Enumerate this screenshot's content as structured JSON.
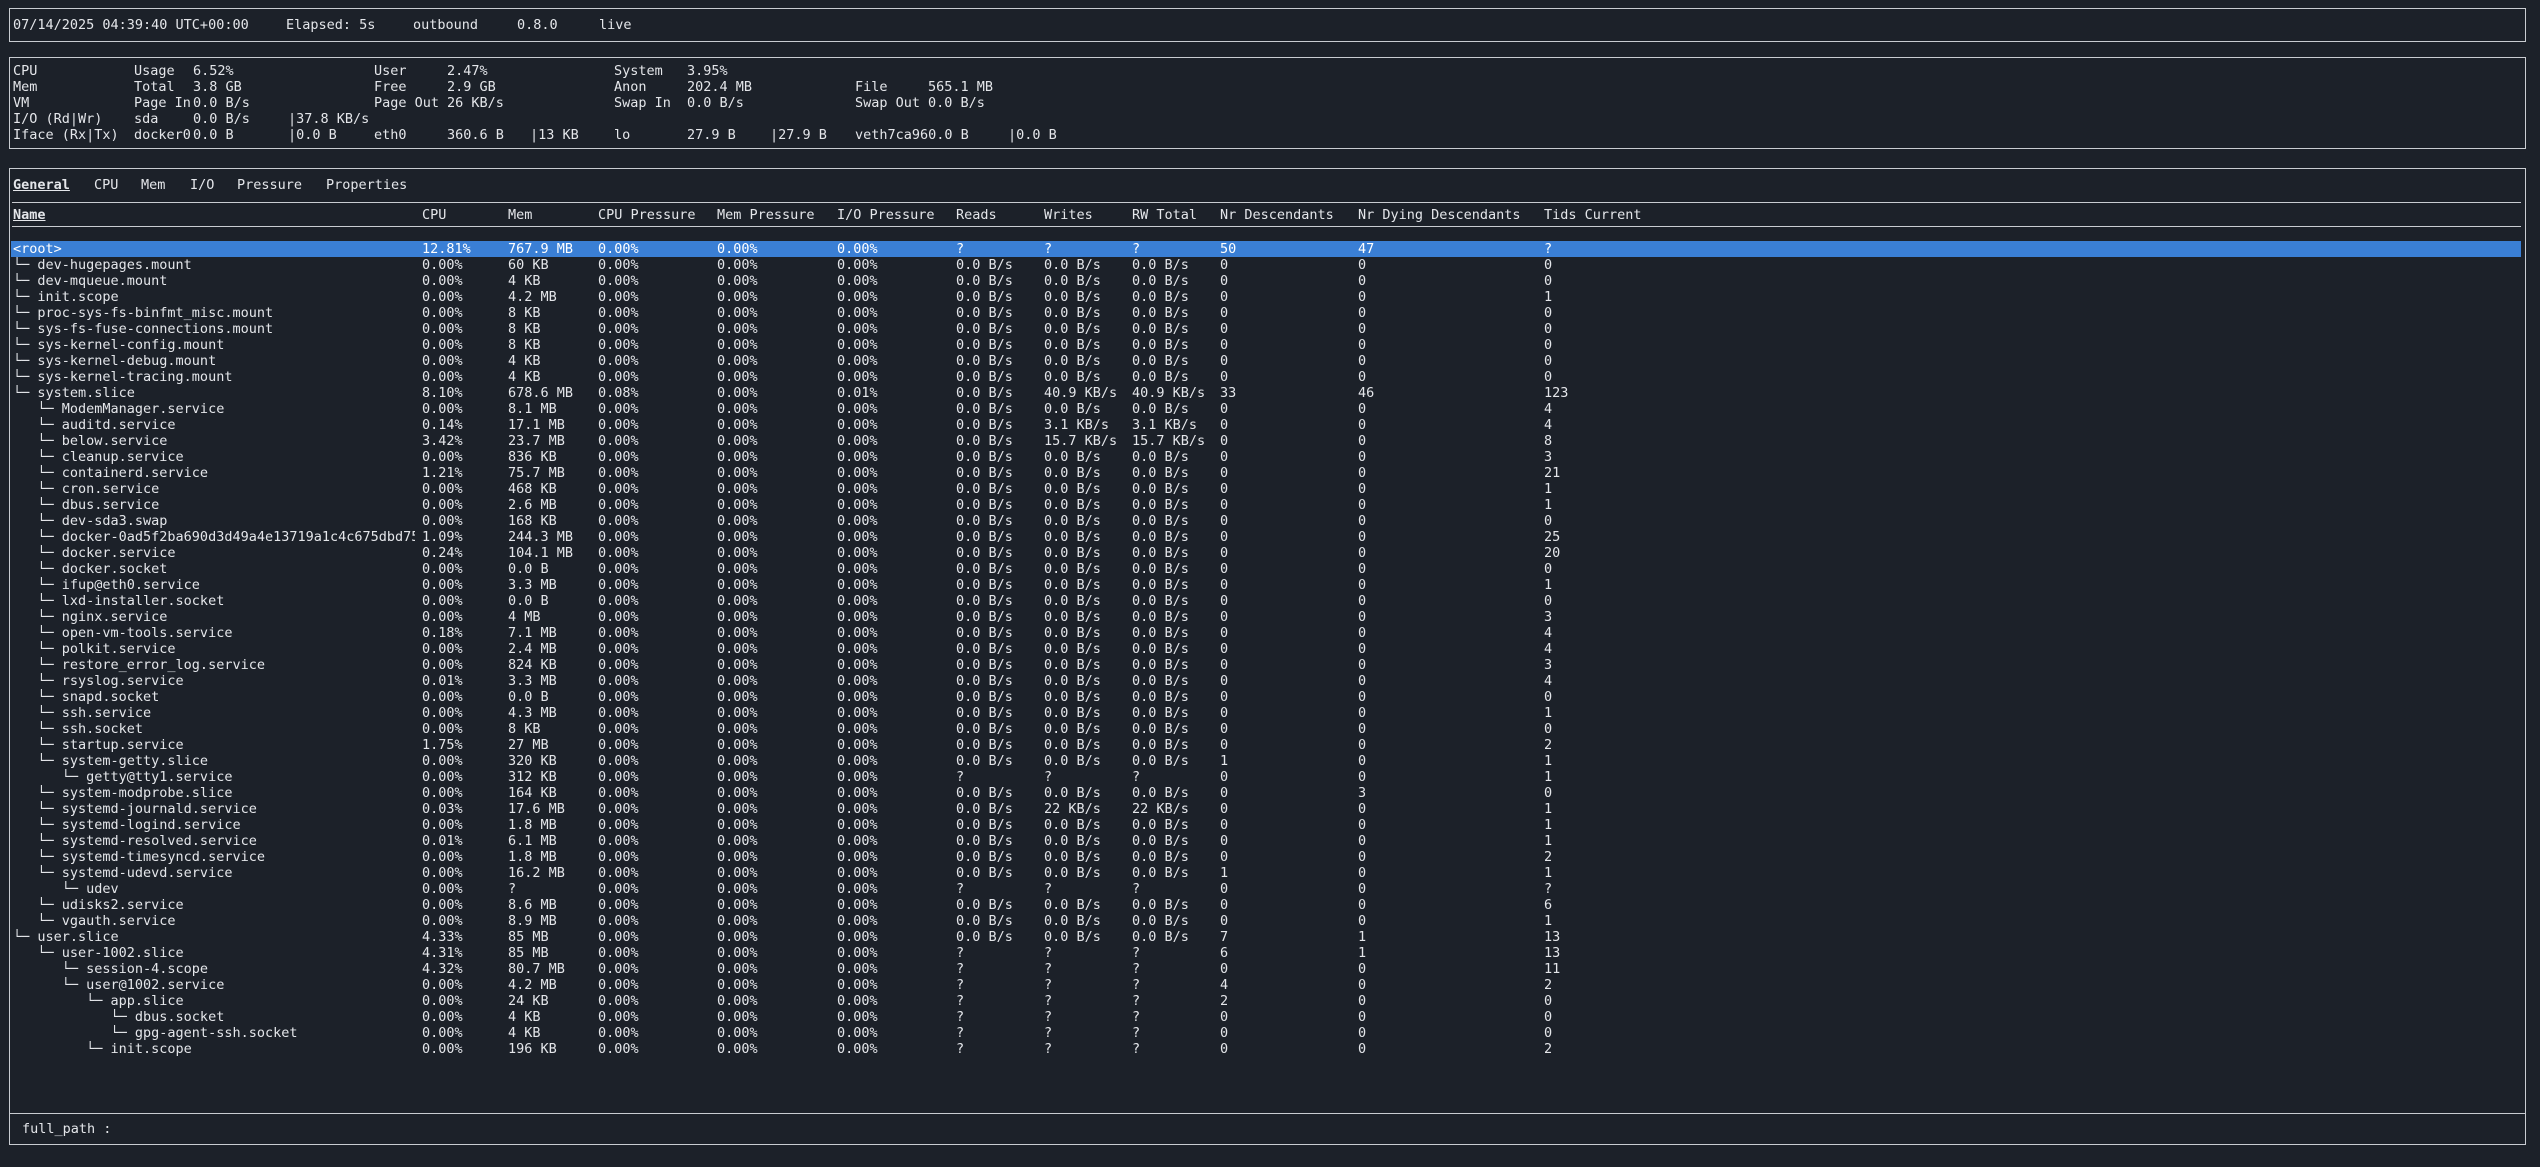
{
  "status_bar": {
    "timestamp": "07/14/2025 04:39:40 UTC+00:00",
    "elapsed": "Elapsed: 5s",
    "direction": "outbound",
    "version": "0.8.0",
    "mode": "live"
  },
  "system_stats": {
    "rows": [
      [
        "CPU",
        "Usage",
        "6.52%",
        "User",
        "2.47%",
        "System",
        "3.95%",
        "",
        ""
      ],
      [
        "Mem",
        "Total",
        "3.8 GB",
        "Free",
        "2.9 GB",
        "Anon",
        "202.4 MB",
        "File",
        "565.1 MB"
      ],
      [
        "VM",
        "Page In",
        "0.0 B/s",
        "Page Out",
        "26 KB/s",
        "Swap In",
        "0.0 B/s",
        "Swap Out",
        "0.0 B/s"
      ]
    ],
    "io_row": [
      "I/O (Rd|Wr)",
      "sda",
      "0.0 B/s",
      "|37.8 KB/s"
    ],
    "iface_row": [
      "Iface (Rx|Tx)",
      "docker0",
      "0.0 B",
      "|0.0 B",
      "eth0",
      "360.6 B",
      "|13 KB",
      "lo",
      "27.9 B",
      "|27.9 B",
      "veth7ca960.0 B",
      "|0.0 B"
    ]
  },
  "tabs": [
    "General",
    "CPU",
    "Mem",
    "I/O",
    "Pressure",
    "Properties"
  ],
  "columns": [
    "Name",
    "CPU",
    "Mem",
    "CPU Pressure",
    "Mem Pressure",
    "I/O Pressure",
    "Reads",
    "Writes",
    "RW Total",
    "Nr Descendants",
    "Nr Dying Descendants",
    "Tids Current"
  ],
  "rows": [
    [
      "<root>",
      "12.81%",
      "767.9 MB",
      "0.00%",
      "0.00%",
      "0.00%",
      "?",
      "?",
      "?",
      "50",
      "47",
      "?"
    ],
    [
      "└─ dev-hugepages.mount",
      "0.00%",
      "60 KB",
      "0.00%",
      "0.00%",
      "0.00%",
      "0.0 B/s",
      "0.0 B/s",
      "0.0 B/s",
      "0",
      "0",
      "0"
    ],
    [
      "└─ dev-mqueue.mount",
      "0.00%",
      "4 KB",
      "0.00%",
      "0.00%",
      "0.00%",
      "0.0 B/s",
      "0.0 B/s",
      "0.0 B/s",
      "0",
      "0",
      "0"
    ],
    [
      "└─ init.scope",
      "0.00%",
      "4.2 MB",
      "0.00%",
      "0.00%",
      "0.00%",
      "0.0 B/s",
      "0.0 B/s",
      "0.0 B/s",
      "0",
      "0",
      "1"
    ],
    [
      "└─ proc-sys-fs-binfmt_misc.mount",
      "0.00%",
      "8 KB",
      "0.00%",
      "0.00%",
      "0.00%",
      "0.0 B/s",
      "0.0 B/s",
      "0.0 B/s",
      "0",
      "0",
      "0"
    ],
    [
      "└─ sys-fs-fuse-connections.mount",
      "0.00%",
      "8 KB",
      "0.00%",
      "0.00%",
      "0.00%",
      "0.0 B/s",
      "0.0 B/s",
      "0.0 B/s",
      "0",
      "0",
      "0"
    ],
    [
      "└─ sys-kernel-config.mount",
      "0.00%",
      "8 KB",
      "0.00%",
      "0.00%",
      "0.00%",
      "0.0 B/s",
      "0.0 B/s",
      "0.0 B/s",
      "0",
      "0",
      "0"
    ],
    [
      "└─ sys-kernel-debug.mount",
      "0.00%",
      "4 KB",
      "0.00%",
      "0.00%",
      "0.00%",
      "0.0 B/s",
      "0.0 B/s",
      "0.0 B/s",
      "0",
      "0",
      "0"
    ],
    [
      "└─ sys-kernel-tracing.mount",
      "0.00%",
      "4 KB",
      "0.00%",
      "0.00%",
      "0.00%",
      "0.0 B/s",
      "0.0 B/s",
      "0.0 B/s",
      "0",
      "0",
      "0"
    ],
    [
      "└─ system.slice",
      "8.10%",
      "678.6 MB",
      "0.08%",
      "0.00%",
      "0.01%",
      "0.0 B/s",
      "40.9 KB/s",
      "40.9 KB/s",
      "33",
      "46",
      "123"
    ],
    [
      "   └─ ModemManager.service",
      "0.00%",
      "8.1 MB",
      "0.00%",
      "0.00%",
      "0.00%",
      "0.0 B/s",
      "0.0 B/s",
      "0.0 B/s",
      "0",
      "0",
      "4"
    ],
    [
      "   └─ auditd.service",
      "0.14%",
      "17.1 MB",
      "0.00%",
      "0.00%",
      "0.00%",
      "0.0 B/s",
      "3.1 KB/s",
      "3.1 KB/s",
      "0",
      "0",
      "4"
    ],
    [
      "   └─ below.service",
      "3.42%",
      "23.7 MB",
      "0.00%",
      "0.00%",
      "0.00%",
      "0.0 B/s",
      "15.7 KB/s",
      "15.7 KB/s",
      "0",
      "0",
      "8"
    ],
    [
      "   └─ cleanup.service",
      "0.00%",
      "836 KB",
      "0.00%",
      "0.00%",
      "0.00%",
      "0.0 B/s",
      "0.0 B/s",
      "0.0 B/s",
      "0",
      "0",
      "3"
    ],
    [
      "   └─ containerd.service",
      "1.21%",
      "75.7 MB",
      "0.00%",
      "0.00%",
      "0.00%",
      "0.0 B/s",
      "0.0 B/s",
      "0.0 B/s",
      "0",
      "0",
      "21"
    ],
    [
      "   └─ cron.service",
      "0.00%",
      "468 KB",
      "0.00%",
      "0.00%",
      "0.00%",
      "0.0 B/s",
      "0.0 B/s",
      "0.0 B/s",
      "0",
      "0",
      "1"
    ],
    [
      "   └─ dbus.service",
      "0.00%",
      "2.6 MB",
      "0.00%",
      "0.00%",
      "0.00%",
      "0.0 B/s",
      "0.0 B/s",
      "0.0 B/s",
      "0",
      "0",
      "1"
    ],
    [
      "   └─ dev-sda3.swap",
      "0.00%",
      "168 KB",
      "0.00%",
      "0.00%",
      "0.00%",
      "0.0 B/s",
      "0.0 B/s",
      "0.0 B/s",
      "0",
      "0",
      "0"
    ],
    [
      "   └─ docker-0ad5f2ba690d3d49a4e13719a1c4c675dbd75",
      "1.09%",
      "244.3 MB",
      "0.00%",
      "0.00%",
      "0.00%",
      "0.0 B/s",
      "0.0 B/s",
      "0.0 B/s",
      "0",
      "0",
      "25"
    ],
    [
      "   └─ docker.service",
      "0.24%",
      "104.1 MB",
      "0.00%",
      "0.00%",
      "0.00%",
      "0.0 B/s",
      "0.0 B/s",
      "0.0 B/s",
      "0",
      "0",
      "20"
    ],
    [
      "   └─ docker.socket",
      "0.00%",
      "0.0 B",
      "0.00%",
      "0.00%",
      "0.00%",
      "0.0 B/s",
      "0.0 B/s",
      "0.0 B/s",
      "0",
      "0",
      "0"
    ],
    [
      "   └─ ifup@eth0.service",
      "0.00%",
      "3.3 MB",
      "0.00%",
      "0.00%",
      "0.00%",
      "0.0 B/s",
      "0.0 B/s",
      "0.0 B/s",
      "0",
      "0",
      "1"
    ],
    [
      "   └─ lxd-installer.socket",
      "0.00%",
      "0.0 B",
      "0.00%",
      "0.00%",
      "0.00%",
      "0.0 B/s",
      "0.0 B/s",
      "0.0 B/s",
      "0",
      "0",
      "0"
    ],
    [
      "   └─ nginx.service",
      "0.00%",
      "4 MB",
      "0.00%",
      "0.00%",
      "0.00%",
      "0.0 B/s",
      "0.0 B/s",
      "0.0 B/s",
      "0",
      "0",
      "3"
    ],
    [
      "   └─ open-vm-tools.service",
      "0.18%",
      "7.1 MB",
      "0.00%",
      "0.00%",
      "0.00%",
      "0.0 B/s",
      "0.0 B/s",
      "0.0 B/s",
      "0",
      "0",
      "4"
    ],
    [
      "   └─ polkit.service",
      "0.00%",
      "2.4 MB",
      "0.00%",
      "0.00%",
      "0.00%",
      "0.0 B/s",
      "0.0 B/s",
      "0.0 B/s",
      "0",
      "0",
      "4"
    ],
    [
      "   └─ restore_error_log.service",
      "0.00%",
      "824 KB",
      "0.00%",
      "0.00%",
      "0.00%",
      "0.0 B/s",
      "0.0 B/s",
      "0.0 B/s",
      "0",
      "0",
      "3"
    ],
    [
      "   └─ rsyslog.service",
      "0.01%",
      "3.3 MB",
      "0.00%",
      "0.00%",
      "0.00%",
      "0.0 B/s",
      "0.0 B/s",
      "0.0 B/s",
      "0",
      "0",
      "4"
    ],
    [
      "   └─ snapd.socket",
      "0.00%",
      "0.0 B",
      "0.00%",
      "0.00%",
      "0.00%",
      "0.0 B/s",
      "0.0 B/s",
      "0.0 B/s",
      "0",
      "0",
      "0"
    ],
    [
      "   └─ ssh.service",
      "0.00%",
      "4.3 MB",
      "0.00%",
      "0.00%",
      "0.00%",
      "0.0 B/s",
      "0.0 B/s",
      "0.0 B/s",
      "0",
      "0",
      "1"
    ],
    [
      "   └─ ssh.socket",
      "0.00%",
      "8 KB",
      "0.00%",
      "0.00%",
      "0.00%",
      "0.0 B/s",
      "0.0 B/s",
      "0.0 B/s",
      "0",
      "0",
      "0"
    ],
    [
      "   └─ startup.service",
      "1.75%",
      "27 MB",
      "0.00%",
      "0.00%",
      "0.00%",
      "0.0 B/s",
      "0.0 B/s",
      "0.0 B/s",
      "0",
      "0",
      "2"
    ],
    [
      "   └─ system-getty.slice",
      "0.00%",
      "320 KB",
      "0.00%",
      "0.00%",
      "0.00%",
      "0.0 B/s",
      "0.0 B/s",
      "0.0 B/s",
      "1",
      "0",
      "1"
    ],
    [
      "      └─ getty@tty1.service",
      "0.00%",
      "312 KB",
      "0.00%",
      "0.00%",
      "0.00%",
      "?",
      "?",
      "?",
      "0",
      "0",
      "1"
    ],
    [
      "   └─ system-modprobe.slice",
      "0.00%",
      "164 KB",
      "0.00%",
      "0.00%",
      "0.00%",
      "0.0 B/s",
      "0.0 B/s",
      "0.0 B/s",
      "0",
      "3",
      "0"
    ],
    [
      "   └─ systemd-journald.service",
      "0.03%",
      "17.6 MB",
      "0.00%",
      "0.00%",
      "0.00%",
      "0.0 B/s",
      "22 KB/s",
      "22 KB/s",
      "0",
      "0",
      "1"
    ],
    [
      "   └─ systemd-logind.service",
      "0.00%",
      "1.8 MB",
      "0.00%",
      "0.00%",
      "0.00%",
      "0.0 B/s",
      "0.0 B/s",
      "0.0 B/s",
      "0",
      "0",
      "1"
    ],
    [
      "   └─ systemd-resolved.service",
      "0.01%",
      "6.1 MB",
      "0.00%",
      "0.00%",
      "0.00%",
      "0.0 B/s",
      "0.0 B/s",
      "0.0 B/s",
      "0",
      "0",
      "1"
    ],
    [
      "   └─ systemd-timesyncd.service",
      "0.00%",
      "1.8 MB",
      "0.00%",
      "0.00%",
      "0.00%",
      "0.0 B/s",
      "0.0 B/s",
      "0.0 B/s",
      "0",
      "0",
      "2"
    ],
    [
      "   └─ systemd-udevd.service",
      "0.00%",
      "16.2 MB",
      "0.00%",
      "0.00%",
      "0.00%",
      "0.0 B/s",
      "0.0 B/s",
      "0.0 B/s",
      "1",
      "0",
      "1"
    ],
    [
      "      └─ udev",
      "0.00%",
      "?",
      "0.00%",
      "0.00%",
      "0.00%",
      "?",
      "?",
      "?",
      "0",
      "0",
      "?"
    ],
    [
      "   └─ udisks2.service",
      "0.00%",
      "8.6 MB",
      "0.00%",
      "0.00%",
      "0.00%",
      "0.0 B/s",
      "0.0 B/s",
      "0.0 B/s",
      "0",
      "0",
      "6"
    ],
    [
      "   └─ vgauth.service",
      "0.00%",
      "8.9 MB",
      "0.00%",
      "0.00%",
      "0.00%",
      "0.0 B/s",
      "0.0 B/s",
      "0.0 B/s",
      "0",
      "0",
      "1"
    ],
    [
      "└─ user.slice",
      "4.33%",
      "85 MB",
      "0.00%",
      "0.00%",
      "0.00%",
      "0.0 B/s",
      "0.0 B/s",
      "0.0 B/s",
      "7",
      "1",
      "13"
    ],
    [
      "   └─ user-1002.slice",
      "4.31%",
      "85 MB",
      "0.00%",
      "0.00%",
      "0.00%",
      "?",
      "?",
      "?",
      "6",
      "1",
      "13"
    ],
    [
      "      └─ session-4.scope",
      "4.32%",
      "80.7 MB",
      "0.00%",
      "0.00%",
      "0.00%",
      "?",
      "?",
      "?",
      "0",
      "0",
      "11"
    ],
    [
      "      └─ user@1002.service",
      "0.00%",
      "4.2 MB",
      "0.00%",
      "0.00%",
      "0.00%",
      "?",
      "?",
      "?",
      "4",
      "0",
      "2"
    ],
    [
      "         └─ app.slice",
      "0.00%",
      "24 KB",
      "0.00%",
      "0.00%",
      "0.00%",
      "?",
      "?",
      "?",
      "2",
      "0",
      "0"
    ],
    [
      "            └─ dbus.socket",
      "0.00%",
      "4 KB",
      "0.00%",
      "0.00%",
      "0.00%",
      "?",
      "?",
      "?",
      "0",
      "0",
      "0"
    ],
    [
      "            └─ gpg-agent-ssh.socket",
      "0.00%",
      "4 KB",
      "0.00%",
      "0.00%",
      "0.00%",
      "?",
      "?",
      "?",
      "0",
      "0",
      "0"
    ],
    [
      "         └─ init.scope",
      "0.00%",
      "196 KB",
      "0.00%",
      "0.00%",
      "0.00%",
      "?",
      "?",
      "?",
      "0",
      "0",
      "2"
    ]
  ],
  "command_bar": {
    "label": "full_path :",
    "value": ""
  },
  "colors": {
    "background": "#1c2129",
    "text": "#e4e6ea",
    "border": "#c9ccd1",
    "selection": "#3a7fd5"
  }
}
